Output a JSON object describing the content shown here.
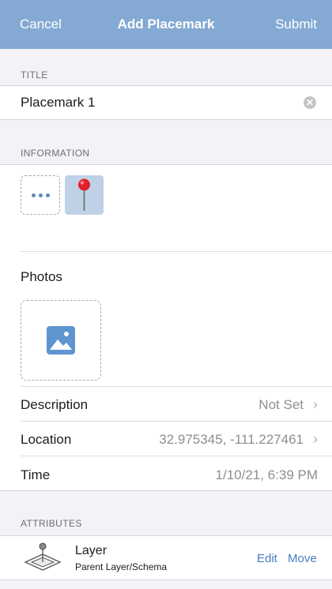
{
  "navbar": {
    "cancel_label": "Cancel",
    "title": "Add Placemark",
    "submit_label": "Submit",
    "color": "#84a9d3"
  },
  "title_section": {
    "header": "TITLE",
    "value": "Placemark 1"
  },
  "information_section": {
    "header": "INFORMATION",
    "more_icon": "ellipsis-icon",
    "selected_icon": "red-pin-icon"
  },
  "photos": {
    "label": "Photos",
    "add_icon": "image-icon"
  },
  "details": {
    "description_label": "Description",
    "description_value": "Not Set",
    "location_label": "Location",
    "location_value": "32.975345, -111.227461",
    "time_label": "Time",
    "time_value": "1/10/21, 6:39 PM"
  },
  "attributes_section": {
    "header": "ATTRIBUTES",
    "layer_name": "Layer",
    "layer_path": "Parent Layer/Schema",
    "edit_label": "Edit",
    "move_label": "Move",
    "accent_color": "#4a7cc0"
  }
}
